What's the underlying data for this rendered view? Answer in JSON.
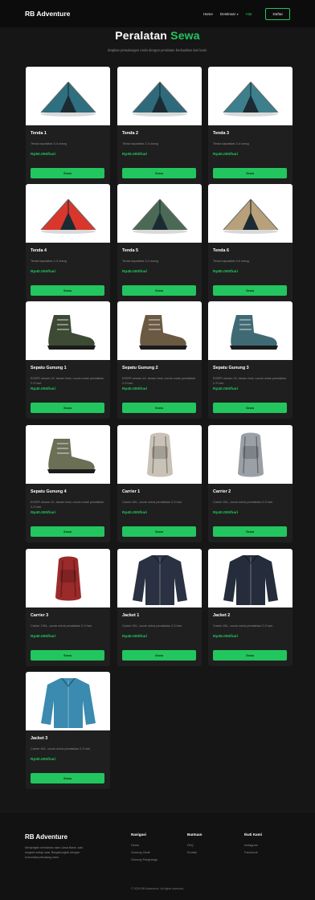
{
  "nav": {
    "brand": "RB Adventure",
    "links": [
      "Home",
      "Destinasi",
      "Alat"
    ],
    "cta": "Daftar"
  },
  "hero": {
    "title": "Peralatan",
    "title_accent": "Sewa",
    "subtitle": "Siapkan petualangan Anda dengan peralatan berkualitas dari kami."
  },
  "products": [
    {
      "name": "Tenda 1",
      "desc": "Tenda kapasitas 3-4 orang",
      "price": "Rp50.000/hari",
      "icon": "tent-icon",
      "button": "Sewa"
    },
    {
      "name": "Tenda 2",
      "desc": "Tenda kapasitas 2-3 orang",
      "price": "Rp35.000/hari",
      "icon": "tent-icon",
      "button": "Sewa"
    },
    {
      "name": "Tenda 3",
      "desc": "Tenda kapasitas 3-4 orang",
      "price": "Rp40.000/hari",
      "icon": "tent-icon",
      "button": "Sewa"
    },
    {
      "name": "Tenda 4",
      "desc": "Tenda kapasitas 2-3 orang",
      "price": "Rp40.000/hari",
      "icon": "tent-icon",
      "button": "Sewa"
    },
    {
      "name": "Tenda 5",
      "desc": "Tenda kapasitas 3-4 orang",
      "price": "Rp45.000/hari",
      "icon": "tent-icon",
      "button": "Sewa"
    },
    {
      "name": "Tenda 6",
      "desc": "Tenda kapasitas 5-6 orang",
      "price": "Rp80.000/hari",
      "icon": "tent-icon",
      "button": "Sewa"
    },
    {
      "name": "Sepatu Gunung 1",
      "desc": "EIGER ukuran 42, tanam besi, cocok untuk pendakian 2-3 hari.",
      "price": "Rp40.000/hari",
      "icon": "hiking-boot-icon",
      "button": "Sewa"
    },
    {
      "name": "Sepatu Gunung 2",
      "desc": "EIGER ukuran 44, tanam besi, cocok untuk pendakian 2-3 hari.",
      "price": "Rp40.000/hari",
      "icon": "hiking-boot-icon",
      "button": "Sewa"
    },
    {
      "name": "Sepatu Gunung 3",
      "desc": "EIGER ukuran 43, tanam besi, cocok untuk pendakian 2-3 hari.",
      "price": "Rp40.000/hari",
      "icon": "hiking-boot-icon",
      "button": "Sewa"
    },
    {
      "name": "Sepatu Gunung 4",
      "desc": "EIGER ukuran 41, tanam besi, cocok untuk pendakian 2-3 hari.",
      "price": "Rp40.000/hari",
      "icon": "hiking-boot-icon",
      "button": "Sewa"
    },
    {
      "name": "Carrier 1",
      "desc": "Carrier 60L, cocok untuk pendakian 2-3 hari.",
      "price": "Rp40.000/hari",
      "icon": "backpack-icon",
      "button": "Sewa"
    },
    {
      "name": "Carrier 2",
      "desc": "Carrier 60L, cocok untuk pendakian 2-3 hari.",
      "price": "Rp40.000/hari",
      "icon": "backpack-icon",
      "button": "Sewa"
    },
    {
      "name": "Carrier 3",
      "desc": "Carrier 100L, cocok untuk pendakian 2-3 hari.",
      "price": "Rp40.000/hari",
      "icon": "backpack-icon",
      "button": "Sewa"
    },
    {
      "name": "Jacket 1",
      "desc": "Carrier 60L, cocok untuk pendakian 2-3 hari.",
      "price": "Rp40.000/hari",
      "icon": "jacket-icon",
      "button": "Sewa"
    },
    {
      "name": "Jacket 2",
      "desc": "Carrier 60L, cocok untuk pendakian 2-3 hari.",
      "price": "Rp35.000/hari",
      "icon": "jacket-icon",
      "button": "Sewa"
    },
    {
      "name": "Jacket 3",
      "desc": "Carrier 60L, cocok untuk pendakian 2-3 hari.",
      "price": "Rp30.000/hari",
      "icon": "jacket-icon",
      "button": "Sewa"
    }
  ],
  "footer": {
    "brand": "RB Adventure",
    "desc": "Menjelajahi keindahan alam Jawa Barat, satu langkah setiap saat. Bergabunglah dengan komunitas petualang kami.",
    "nav_title": "Navigasi",
    "nav_links": [
      "Home",
      "Gunung Gede",
      "Gunung Pangrango"
    ],
    "help_title": "Bantuan",
    "help_links": [
      "FAQ",
      "Kontak"
    ],
    "follow_title": "Ikuti Kami",
    "follow_links": [
      "Instagram",
      "Facebook"
    ],
    "copyright": "© 2025 RB Adventure. All rights reserved."
  },
  "colors": {
    "accent": "#22c55e",
    "background": "#161616",
    "card": "#1f1f1f"
  }
}
